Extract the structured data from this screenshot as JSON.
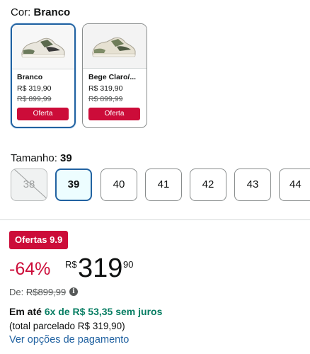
{
  "color": {
    "label": "Cor:",
    "value": "Branco"
  },
  "variants": [
    {
      "name": "Branco",
      "price": "R$ 319,90",
      "old_price": "R$ 899,99",
      "deal": "Oferta",
      "selected": true
    },
    {
      "name": "Bege Claro/...",
      "price": "R$ 319,90",
      "old_price": "R$ 899,99",
      "deal": "Oferta",
      "selected": false
    }
  ],
  "size": {
    "label": "Tamanho:",
    "value": "39"
  },
  "sizes": [
    {
      "value": "38",
      "state": "unavailable"
    },
    {
      "value": "39",
      "state": "selected"
    },
    {
      "value": "40",
      "state": "available"
    },
    {
      "value": "41",
      "state": "available"
    },
    {
      "value": "42",
      "state": "available"
    },
    {
      "value": "43",
      "state": "available"
    },
    {
      "value": "44",
      "state": "available"
    }
  ],
  "deal_badge": "Ofertas 9.9",
  "price": {
    "discount": "-64%",
    "currency": "R$",
    "whole": "319",
    "fraction": "90",
    "old_label": "De:",
    "old_value": "R$899,99"
  },
  "installments": {
    "prefix": "Em até",
    "offer": "6x de R$ 53,35 sem juros",
    "total": "(total parcelado R$ 319,90)"
  },
  "payment_link": "Ver opções de pagamento",
  "colors": {
    "selected_border": "#2162a1",
    "deal_red": "#cc0c39",
    "installment_green": "#067d62",
    "link_blue": "#2162a1"
  },
  "icons": {
    "info": "info-icon",
    "shoe": "sneaker-thumbnail"
  }
}
